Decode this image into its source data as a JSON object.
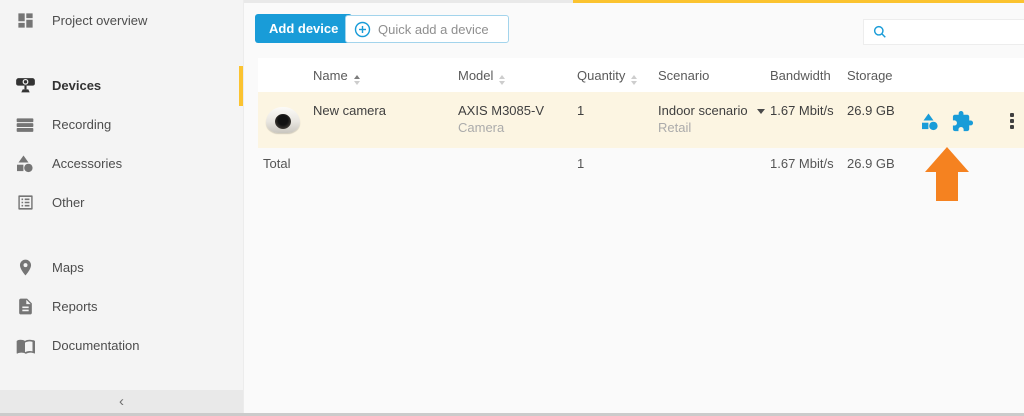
{
  "sidebar": {
    "items": [
      {
        "label": "Project overview",
        "icon": "dashboard-icon",
        "active": false
      },
      {
        "label": "Devices",
        "icon": "camera-icon",
        "active": true
      },
      {
        "label": "Recording",
        "icon": "server-icon",
        "active": false
      },
      {
        "label": "Accessories",
        "icon": "shapes-icon",
        "active": false
      },
      {
        "label": "Other",
        "icon": "list-icon",
        "active": false
      },
      {
        "label": "Maps",
        "icon": "map-pin-icon",
        "active": false
      },
      {
        "label": "Reports",
        "icon": "document-icon",
        "active": false
      },
      {
        "label": "Documentation",
        "icon": "book-icon",
        "active": false
      }
    ],
    "collapse_label": "‹"
  },
  "toolbar": {
    "add_device_label": "Add device",
    "quick_add_placeholder": "Quick add a device"
  },
  "search": {
    "placeholder": ""
  },
  "table": {
    "columns": [
      {
        "label": "Name",
        "sortable": true,
        "sorted": "asc"
      },
      {
        "label": "Model",
        "sortable": true,
        "sorted": "none"
      },
      {
        "label": "Quantity",
        "sortable": true,
        "sorted": "none"
      },
      {
        "label": "Scenario",
        "sortable": false
      },
      {
        "label": "Bandwidth",
        "sortable": false
      },
      {
        "label": "Storage",
        "sortable": false
      }
    ],
    "rows": [
      {
        "name": "New camera",
        "model": "AXIS M3085-V",
        "model_type": "Camera",
        "quantity": "1",
        "scenario": "Indoor scenario",
        "scenario_sub": "Retail",
        "bandwidth": "1.67 Mbit/s",
        "storage": "26.9 GB"
      }
    ],
    "total": {
      "label": "Total",
      "quantity": "1",
      "bandwidth": "1.67 Mbit/s",
      "storage": "26.9 GB"
    }
  },
  "colors": {
    "primary_blue": "#199cd8",
    "accent_yellow": "#fbc330",
    "row_highlight": "#fcf5e2",
    "arrow_orange": "#f58220",
    "sidebar_bg": "#f4f4f4"
  }
}
